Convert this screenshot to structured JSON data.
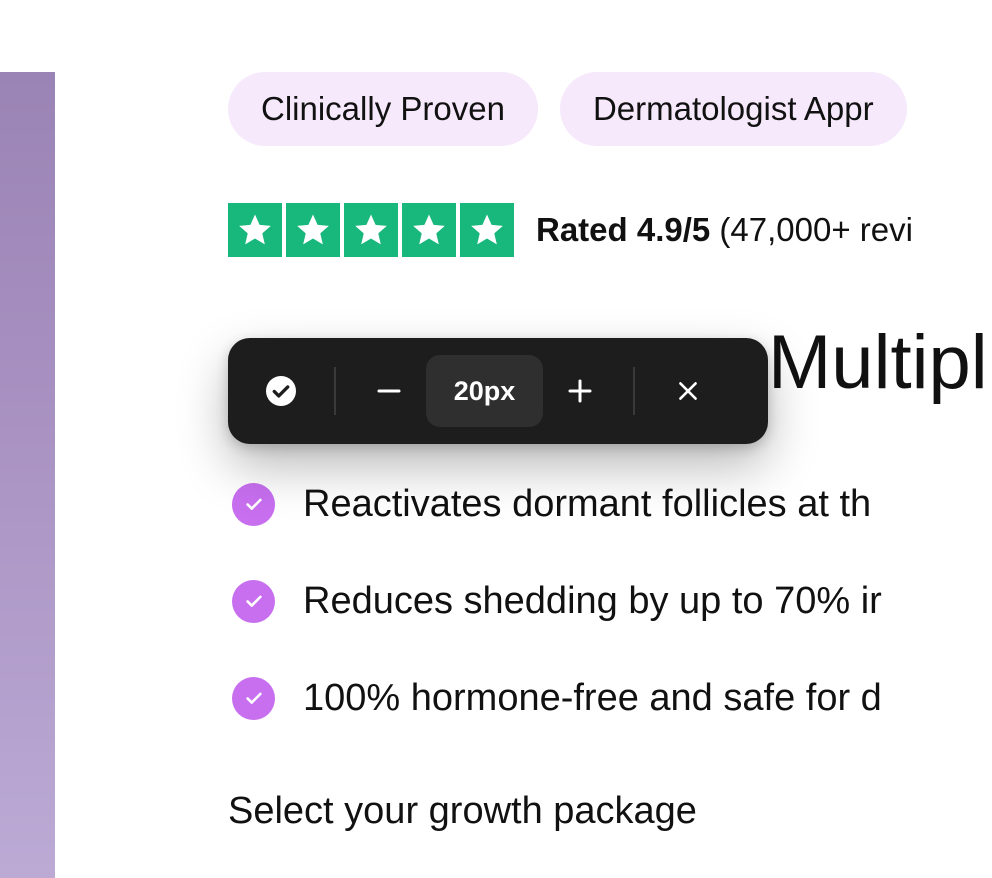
{
  "badges": [
    "Clinically Proven",
    "Dermatologist Appr"
  ],
  "rating": {
    "stars": 5,
    "label": "Rated 4.9/5",
    "reviews": "(47,000+ revi",
    "star_color": "#18b77c"
  },
  "headline": {
    "visible_text": "Multipl"
  },
  "benefits": [
    "Reactivates dormant follicles at th",
    "Reduces shedding by up to 70% ir",
    "100% hormone-free and safe for d"
  ],
  "package": {
    "title": "Select your growth package"
  },
  "toolbar": {
    "value": "20px",
    "confirm_icon": "check-circle-icon",
    "decrease_icon": "minus-icon",
    "increase_icon": "plus-icon",
    "close_icon": "close-icon"
  },
  "colors": {
    "badge_bg": "#f6e9fb",
    "check_bg": "#c86ff0",
    "toolbar_bg": "#1d1d1d",
    "side_image": "#a68fc0"
  }
}
